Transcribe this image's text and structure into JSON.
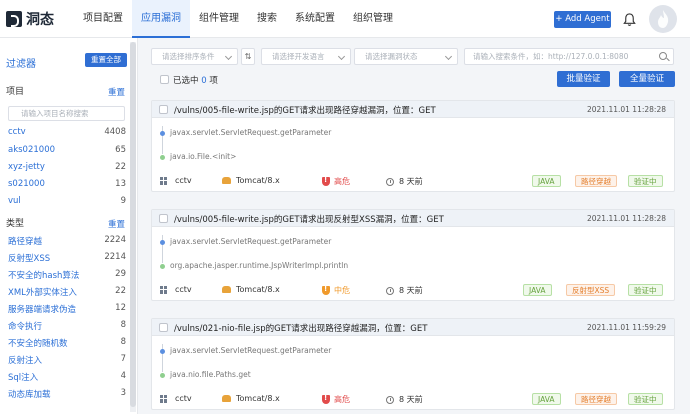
{
  "app": {
    "name": "洞态"
  },
  "nav": [
    {
      "label": "项目配置",
      "active": false
    },
    {
      "label": "应用漏洞",
      "active": true
    },
    {
      "label": "组件管理",
      "active": false
    },
    {
      "label": "搜索",
      "active": false
    },
    {
      "label": "系统配置",
      "active": false
    },
    {
      "label": "组织管理",
      "active": false
    }
  ],
  "header": {
    "add_agent_label": "+ Add Agent"
  },
  "sidebar": {
    "title": "过滤器",
    "reset_all": "重置全部",
    "project_section": {
      "title": "项目",
      "reset": "重置",
      "search_placeholder": "请输入项目名称搜索",
      "items": [
        {
          "label": "cctv",
          "count": "4408"
        },
        {
          "label": "aks021000",
          "count": "65"
        },
        {
          "label": "xyz-jetty",
          "count": "22"
        },
        {
          "label": "s021000",
          "count": "13"
        },
        {
          "label": "vul",
          "count": "9"
        }
      ]
    },
    "type_section": {
      "title": "类型",
      "reset": "重置",
      "items": [
        {
          "label": "路径穿越",
          "count": "2224"
        },
        {
          "label": "反射型XSS",
          "count": "2214"
        },
        {
          "label": "不安全的hash算法",
          "count": "29"
        },
        {
          "label": "XML外部实体注入",
          "count": "22"
        },
        {
          "label": "服务器端请求伪造",
          "count": "12"
        },
        {
          "label": "命令执行",
          "count": "8"
        },
        {
          "label": "不安全的随机数",
          "count": "8"
        },
        {
          "label": "反射注入",
          "count": "7"
        },
        {
          "label": "Sql注入",
          "count": "4"
        },
        {
          "label": "动态库加载",
          "count": "3"
        }
      ]
    }
  },
  "filters": {
    "sort_placeholder": "请选择排序条件",
    "sort_toggle": "⇅",
    "language_placeholder": "请选择开发语言",
    "status_placeholder": "请选择漏洞状态",
    "search_placeholder": "请输入搜索条件，如：http://127.0.0.1:8080"
  },
  "selection": {
    "prefix": "已选中",
    "count": "0",
    "suffix": "项"
  },
  "actions": {
    "batch_verify": "批量验证",
    "full_verify": "全量验证"
  },
  "colors": {
    "primary": "#2f6ed3",
    "high_risk": "#e24b4b",
    "medium_risk": "#f09a2c"
  },
  "vulns": [
    {
      "title": "/vulns/005-file-write.jsp的GET请求出现路径穿越漏洞，位置：GET",
      "time": "2021.11.01 11:28:28",
      "traces": [
        "javax.servlet.ServletRequest.getParameter",
        "java.io.File.<init>"
      ],
      "project": "cctv",
      "server": "Tomcat/8.x",
      "level": "高危",
      "level_color": "#e24b4b",
      "age": "8 天前",
      "tags": [
        {
          "label": "JAVA",
          "style": "green"
        },
        {
          "label": "路径穿越",
          "style": "orange"
        },
        {
          "label": "验证中",
          "style": "green"
        }
      ]
    },
    {
      "title": "/vulns/005-file-write.jsp的GET请求出现反射型XSS漏洞，位置：GET",
      "time": "2021.11.01 11:28:28",
      "traces": [
        "javax.servlet.ServletRequest.getParameter",
        "org.apache.jasper.runtime.JspWriterImpl.println"
      ],
      "project": "cctv",
      "server": "Tomcat/8.x",
      "level": "中危",
      "level_color": "#f09a2c",
      "age": "8 天前",
      "tags": [
        {
          "label": "JAVA",
          "style": "green"
        },
        {
          "label": "反射型XSS",
          "style": "orange"
        },
        {
          "label": "验证中",
          "style": "green"
        }
      ]
    },
    {
      "title": "/vulns/021-nio-file.jsp的GET请求出现路径穿越漏洞，位置：GET",
      "time": "2021.11.01 11:59:29",
      "traces": [
        "javax.servlet.ServletRequest.getParameter",
        "java.nio.file.Paths.get"
      ],
      "project": "cctv",
      "server": "Tomcat/8.x",
      "level": "高危",
      "level_color": "#e24b4b",
      "age": "8 天前",
      "tags": [
        {
          "label": "JAVA",
          "style": "green"
        },
        {
          "label": "路径穿越",
          "style": "orange"
        },
        {
          "label": "验证中",
          "style": "green"
        }
      ]
    }
  ]
}
